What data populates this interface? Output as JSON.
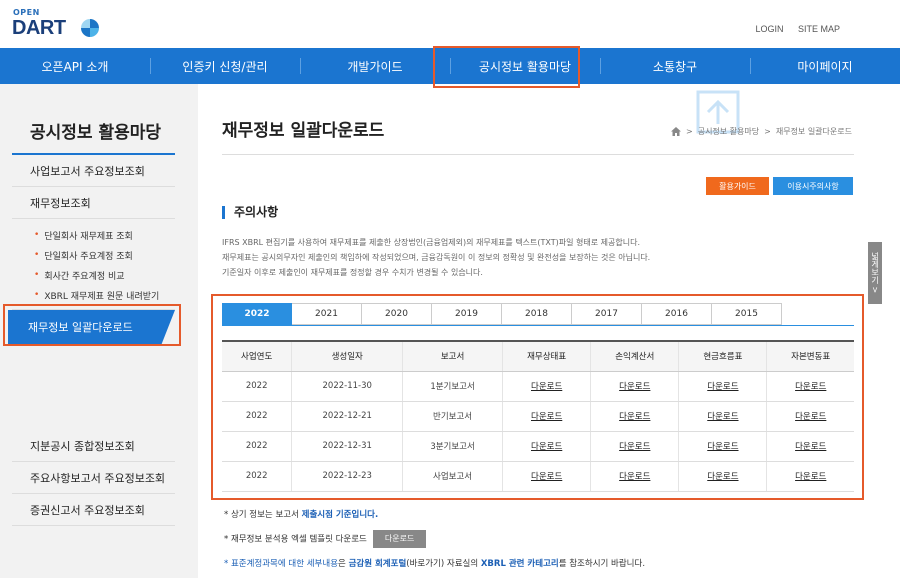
{
  "header": {
    "logo_top": "OPEN",
    "logo_main": "DART",
    "login": "LOGIN",
    "sitemap": "SITE MAP"
  },
  "gnb": [
    "오픈API 소개",
    "인증키 신청/관리",
    "개발가이드",
    "공시정보 활용마당",
    "소통창구",
    "마이페이지"
  ],
  "sidebar": {
    "title": "공시정보 활용마당",
    "items_top": [
      "사업보고서 주요정보조회",
      "재무정보조회"
    ],
    "sub_items": [
      "단일회사 재무제표 조회",
      "단일회사 주요계정 조회",
      "회사간 주요계정 비교",
      "XBRL 재무제표 원문 내려받기"
    ],
    "active": "재무정보 일괄다운로드",
    "items_bottom": [
      "지분공시 종합정보조회",
      "주요사항보고서 주요정보조회",
      "증권신고서 주요정보조회"
    ]
  },
  "content": {
    "title": "재무정보 일괄다운로드",
    "breadcrumb": [
      "공시정보 활용마당",
      "재무정보 일괄다운로드"
    ],
    "btn_guide": "활용가이드",
    "btn_notice": "이용시주의사항",
    "section_title": "주의사항",
    "notice_lines": [
      "IFRS XBRL 편집기를 사용하여 재무제표를 제출한 상장법인(금융업제외)의 재무제표를 텍스트(TXT)파일 형태로 제공합니다.",
      "재무제표는 공시의무자인 제출인의 책임하에 작성되었으며, 금융감독원이 이 정보의 정확성 및 완전성을 보장하는 것은 아닙니다.",
      "기준일자 이후로 제출인이 재무제표를 정정할 경우 수치가 변경될 수 있습니다."
    ],
    "side_tab": "넓게보기 >",
    "year_tabs": [
      "2022",
      "2021",
      "2020",
      "2019",
      "2018",
      "2017",
      "2016",
      "2015"
    ],
    "active_year": "2022",
    "table": {
      "headers": [
        "사업연도",
        "생성일자",
        "보고서",
        "재무상태표",
        "손익계산서",
        "현금흐름표",
        "자본변동표"
      ],
      "rows": [
        [
          "2022",
          "2022-11-30",
          "1분기보고서",
          "다운로드",
          "다운로드",
          "다운로드",
          "다운로드"
        ],
        [
          "2022",
          "2022-12-21",
          "반기보고서",
          "다운로드",
          "다운로드",
          "다운로드",
          "다운로드"
        ],
        [
          "2022",
          "2022-12-31",
          "3분기보고서",
          "다운로드",
          "다운로드",
          "다운로드",
          "다운로드"
        ],
        [
          "2022",
          "2022-12-23",
          "사업보고서",
          "다운로드",
          "다운로드",
          "다운로드",
          "다운로드"
        ]
      ]
    },
    "note1": {
      "prefix": "* 상기 정보는 보고서 ",
      "blue": "제출시점 기준입니다."
    },
    "note2": {
      "text": "* 재무정보 분석용 엑셀 템플릿 다운로드",
      "button": "다운로드"
    },
    "note3": {
      "prefix": "* ",
      "blue1": "표준계정과목에 대한 세부내용",
      "mid1": "은 ",
      "blue2": "금감원 회계포털",
      "mid2": "(바로가기) 자료실의 ",
      "blue3": "XBRL 관련 카테고리",
      "suffix": "를 참조하시기 바랍니다."
    }
  },
  "colors": {
    "primary": "#1b75d0",
    "highlight": "#e55a2b",
    "accent_orange": "#f0691d"
  }
}
